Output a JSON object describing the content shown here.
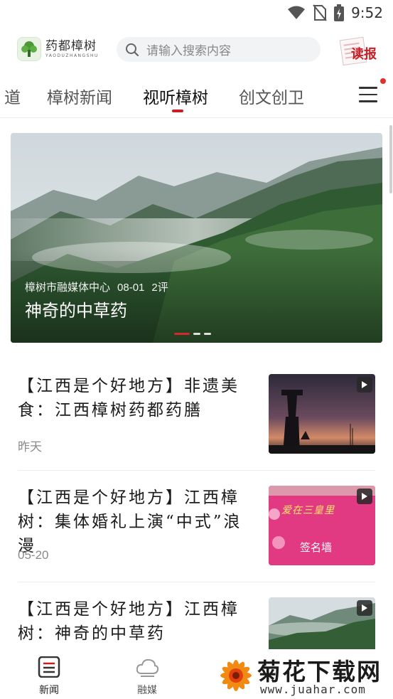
{
  "status_bar": {
    "time": "9:52",
    "icons": [
      "wifi-icon",
      "no-sim-icon",
      "battery-charging-icon"
    ]
  },
  "header": {
    "logo_cn": "药都樟树",
    "logo_en": "YAODUZHANGSHU",
    "search_placeholder": "请输入搜索内容",
    "read_label": "读报"
  },
  "tabs": [
    {
      "label": "道"
    },
    {
      "label": "樟树新闻"
    },
    {
      "label": "视听樟树",
      "active": true
    },
    {
      "label": "创文创卫"
    }
  ],
  "banner": {
    "source": "樟树市融媒体中心",
    "date": "08-01",
    "comments": "2评",
    "title": "神奇的中草药",
    "slides": 3,
    "active_slide": 1
  },
  "news": [
    {
      "title": "【江西是个好地方】非遗美食：江西樟树药都药膳",
      "time": "昨天",
      "thumb": "sunset-tower"
    },
    {
      "title": "【江西是个好地方】江西樟树：集体婚礼上演“中式”浪漫",
      "time": "05-20",
      "thumb": "pink-sign-wall",
      "thumb_text": "签名墙",
      "thumb_caption": "爱在三皇里"
    },
    {
      "title": "【江西是个好地方】江西樟树：神奇的中草药",
      "time": "",
      "thumb": "misty-mountain"
    }
  ],
  "bottom_nav": [
    {
      "label": "新闻",
      "icon": "news-icon",
      "active": true
    },
    {
      "label": "融媒",
      "icon": "cloud-icon",
      "active": false
    }
  ],
  "watermark": {
    "name": "菊花下载网",
    "url": "www.juahar.com"
  },
  "colors": {
    "accent": "#c81e25",
    "text": "#1b1b1b",
    "muted": "#8a8a8a"
  }
}
